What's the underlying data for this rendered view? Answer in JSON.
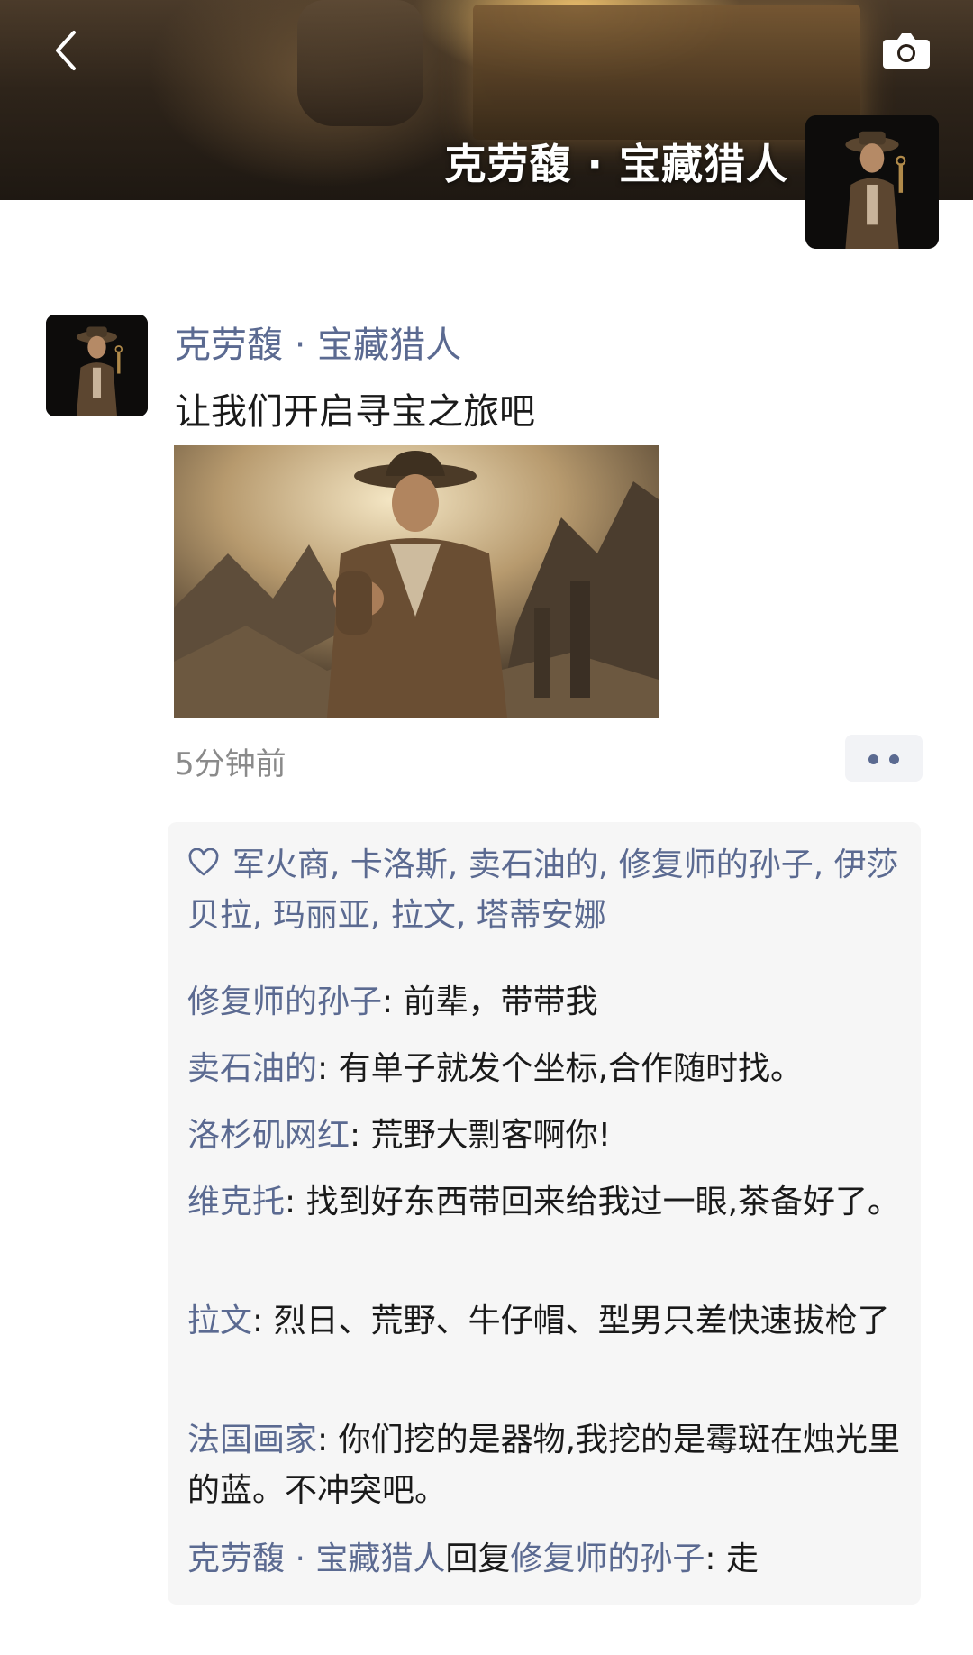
{
  "cover": {
    "title": "克劳馥 · 宝藏猎人"
  },
  "icons": {
    "back": "chevron-left-icon",
    "camera": "camera-icon",
    "like": "heart-icon",
    "more": "more-dots-icon"
  },
  "post": {
    "author": "克劳馥 · 宝藏猎人",
    "text": "让我们开启寻宝之旅吧",
    "time": "5分钟前"
  },
  "likes": {
    "names": [
      "军火商",
      "卡洛斯",
      "卖石油的",
      "修复师的孙子",
      "伊莎贝拉",
      "玛丽亚",
      "拉文",
      "塔蒂安娜"
    ],
    "separator": ", "
  },
  "comments": [
    {
      "name": "修复师的孙子",
      "text": "前辈，带带我"
    },
    {
      "name": "卖石油的",
      "text": "有单子就发个坐标,合作随时找。"
    },
    {
      "name": "洛杉矶网红",
      "text": "荒野大剽客啊你!"
    },
    {
      "name": "维克托",
      "text": "找到好东西带回来给我过一眼,茶备好了。"
    },
    {
      "name": "拉文",
      "text": "烈日、荒野、牛仔帽、型男只差快速拔枪了"
    },
    {
      "name": "法国画家",
      "text": "你们挖的是器物,我挖的是霉斑在烛光里的蓝。不冲突吧。"
    }
  ],
  "reply": {
    "from": "克劳馥 · 宝藏猎人",
    "verb": "回复",
    "to": "修复师的孙子",
    "colon": ": ",
    "text": "走"
  },
  "comment_separator": ": ",
  "colors": {
    "link": "#5b6a91",
    "text": "#1a1a1a",
    "meta": "#8a8a8a",
    "panel": "#f6f6f6"
  }
}
